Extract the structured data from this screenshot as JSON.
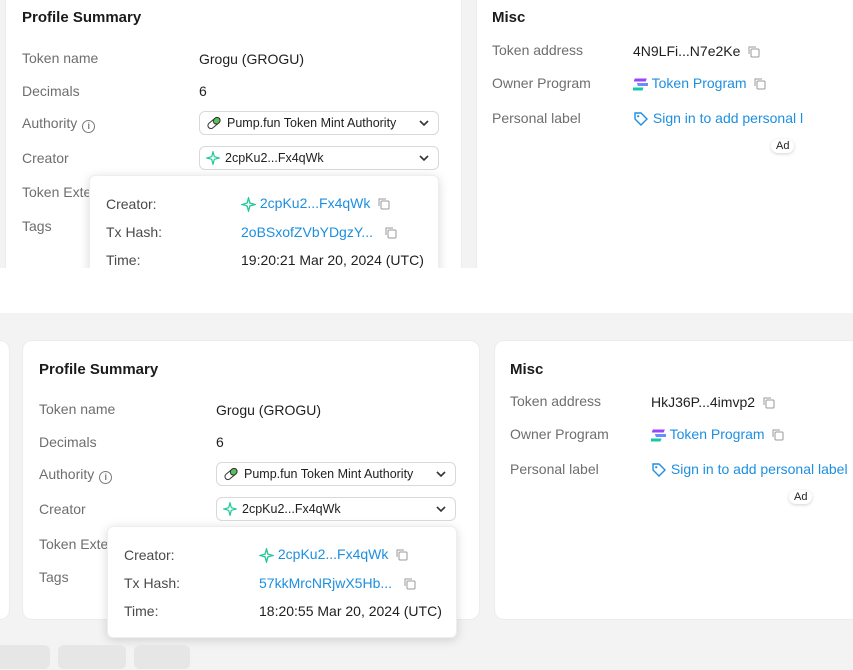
{
  "panels": [
    {
      "profile": {
        "title": "Profile Summary",
        "token_name_label": "Token name",
        "token_name_value": "Grogu (GROGU)",
        "decimals_label": "Decimals",
        "decimals_value": "6",
        "authority_label": "Authority",
        "authority_value": "Pump.fun Token Mint Authority",
        "creator_label": "Creator",
        "creator_value": "2cpKu2...Fx4qWk",
        "token_ext_label": "Token Exte",
        "tags_label": "Tags"
      },
      "tooltip": {
        "creator_label": "Creator:",
        "creator_value": "2cpKu2...Fx4qWk",
        "tx_label": "Tx Hash:",
        "tx_value": "2oBSxofZVbYDgzY...",
        "time_label": "Time:",
        "time_value": "19:20:21 Mar 20, 2024 (UTC)"
      },
      "misc": {
        "title": "Misc",
        "token_address_label": "Token address",
        "token_address_value": "4N9LFi...N7e2Ke",
        "owner_program_label": "Owner Program",
        "owner_program_value": "Token Program",
        "personal_label_label": "Personal label",
        "personal_label_value": "Sign in to add personal l",
        "ad": "Ad"
      }
    },
    {
      "profile": {
        "title": "Profile Summary",
        "token_name_label": "Token name",
        "token_name_value": "Grogu (GROGU)",
        "decimals_label": "Decimals",
        "decimals_value": "6",
        "authority_label": "Authority",
        "authority_value": "Pump.fun Token Mint Authority",
        "creator_label": "Creator",
        "creator_value": "2cpKu2...Fx4qWk",
        "token_ext_label": "Token Exte",
        "tags_label": "Tags"
      },
      "tooltip": {
        "creator_label": "Creator:",
        "creator_value": "2cpKu2...Fx4qWk",
        "tx_label": "Tx Hash:",
        "tx_value": "57kkMrcNRjwX5Hb...",
        "time_label": "Time:",
        "time_value": "18:20:55 Mar 20, 2024 (UTC)"
      },
      "misc": {
        "title": "Misc",
        "token_address_label": "Token address",
        "token_address_value": "HkJ36P...4imvp2",
        "owner_program_label": "Owner Program",
        "owner_program_value": "Token Program",
        "personal_label_label": "Personal label",
        "personal_label_value": "Sign in to add personal label",
        "ad": "Ad"
      },
      "bottom_tabs": [
        "",
        "",
        ""
      ]
    }
  ],
  "colors": {
    "link": "#1d8fe0",
    "creator_star": "#20c997",
    "background": "#f3f3f3"
  },
  "icons": {
    "authority_info": "info-icon",
    "authority_pill": "pill-icon",
    "creator_star": "sparkle-icon",
    "copy": "copy-icon",
    "token_program": "solana-icon",
    "personal_label": "tag-icon",
    "dropdown": "chevron-down-icon"
  }
}
